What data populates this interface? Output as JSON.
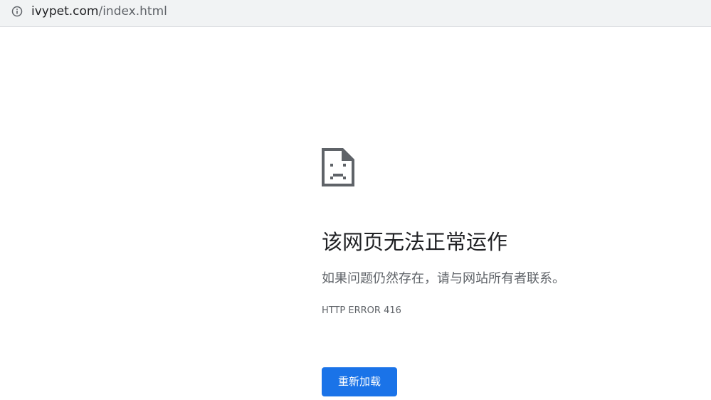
{
  "address_bar": {
    "url_host": "ivypet.com",
    "url_path": "/index.html",
    "info_icon": "info-icon"
  },
  "error_page": {
    "icon": "sad-page-icon",
    "heading": "该网页无法正常运作",
    "message": "如果问题仍然存在，请与网站所有者联系。",
    "error_code": "HTTP ERROR 416",
    "reload_label": "重新加载",
    "accent_color": "#1a73e8"
  }
}
